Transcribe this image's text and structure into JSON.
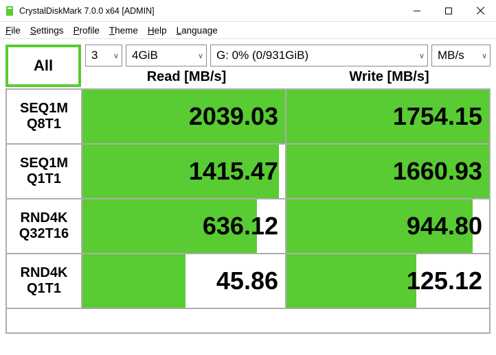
{
  "window": {
    "title": "CrystalDiskMark 7.0.0 x64 [ADMIN]"
  },
  "menu": {
    "file": "File",
    "settings": "Settings",
    "profile": "Profile",
    "theme": "Theme",
    "help": "Help",
    "language": "Language"
  },
  "controls": {
    "all_label": "All",
    "runs": "3",
    "size": "4GiB",
    "drive": "G: 0% (0/931GiB)",
    "unit": "MB/s"
  },
  "headers": {
    "read": "Read [MB/s]",
    "write": "Write [MB/s]"
  },
  "rows": [
    {
      "label1": "SEQ1M",
      "label2": "Q8T1",
      "read": "2039.03",
      "read_pct": 100,
      "write": "1754.15",
      "write_pct": 100
    },
    {
      "label1": "SEQ1M",
      "label2": "Q1T1",
      "read": "1415.47",
      "read_pct": 97,
      "write": "1660.93",
      "write_pct": 100
    },
    {
      "label1": "RND4K",
      "label2": "Q32T16",
      "read": "636.12",
      "read_pct": 86,
      "write": "944.80",
      "write_pct": 92
    },
    {
      "label1": "RND4K",
      "label2": "Q1T1",
      "read": "45.86",
      "read_pct": 51,
      "write": "125.12",
      "write_pct": 64
    }
  ]
}
